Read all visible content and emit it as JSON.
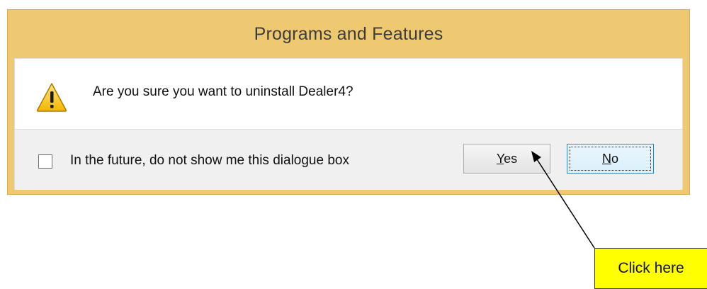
{
  "dialog": {
    "title": "Programs and Features",
    "icon": "warning-icon",
    "message": "Are you sure you want to uninstall Dealer4?",
    "checkbox": {
      "label": "In the future, do not show me this dialogue box",
      "checked": false
    },
    "buttons": {
      "yes": {
        "accel": "Y",
        "rest": "es"
      },
      "no": {
        "accel": "N",
        "rest": "o"
      }
    }
  },
  "annotation": {
    "callout_text": "Click here",
    "callout_color": "#ffff00"
  },
  "colors": {
    "window_frame": "#efc971",
    "footer_bg": "#f0f0f0",
    "focused_button_border": "#3c7fb1"
  }
}
